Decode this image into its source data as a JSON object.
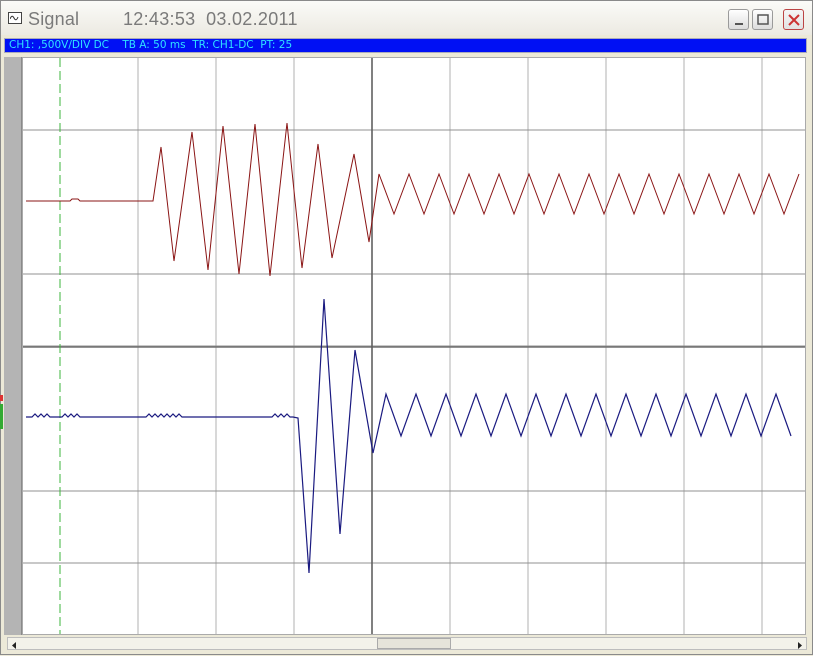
{
  "window": {
    "title": "Signal",
    "timestamp": "12:43:53  03.02.2011",
    "minimize_icon": "minimize-icon",
    "maximize_icon": "maximize-icon",
    "close_icon": "close-icon"
  },
  "status": {
    "text": "CH1: ,500V/DIV DC    TB A: 50 ms  TR: CH1-DC  PT: 25"
  },
  "colors": {
    "status_bar_bg": "#0010f4",
    "status_text": "#2fe2ff",
    "channel1_trace": "#8a1414",
    "channel2_trace": "#1a1a80",
    "cursor_line": "#3cb43c",
    "grid": "#808080"
  },
  "scrollbar": {
    "left_icon": "scroll-left-icon",
    "right_icon": "scroll-right-icon"
  }
}
